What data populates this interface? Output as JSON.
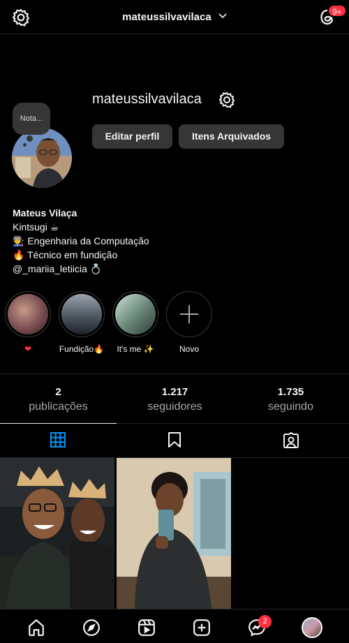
{
  "header": {
    "account_name": "mateussilvavilaca",
    "threads_badge": "9+"
  },
  "profile": {
    "note_label": "Nota...",
    "username": "mateussilvavilaca",
    "edit_button": "Editar perfil",
    "archive_button": "Itens Arquivados",
    "full_name": "Mateus Vilaça",
    "bio_lines": [
      "Kintsugi ☕",
      "👨‍🏭 Engenharia da Computação",
      "🔥 Técnico em fundição",
      "@_mariia_letiicia 💍"
    ]
  },
  "highlights": [
    {
      "label": "❤",
      "color": "#7a4d52"
    },
    {
      "label": "Fundição🔥",
      "color": "#4e5863"
    },
    {
      "label": "It's me ✨",
      "color": "#6d8c7c"
    },
    {
      "label": "Novo",
      "icon": "plus-icon"
    }
  ],
  "stats": [
    {
      "count": "2",
      "label": "publicações"
    },
    {
      "count": "1.217",
      "label": "seguidores"
    },
    {
      "count": "1.735",
      "label": "seguindo"
    }
  ],
  "tabs": [
    {
      "icon": "grid-icon",
      "active": true
    },
    {
      "icon": "saved-icon",
      "active": false
    },
    {
      "icon": "tagged-icon",
      "active": false
    }
  ],
  "bottom_nav": {
    "items": [
      "home-icon",
      "explore-icon",
      "reels-icon",
      "create-icon",
      "messenger-icon",
      "profile-avatar"
    ],
    "messages_badge": "2"
  },
  "colors": {
    "background": "#000000",
    "button": "#363636",
    "badge": "#ff3040",
    "divider": "#262626",
    "active_tab": "#0095f6"
  }
}
